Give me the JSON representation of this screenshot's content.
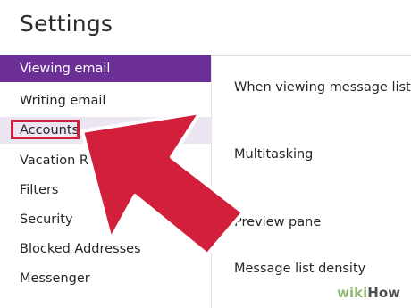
{
  "page": {
    "title": "Settings"
  },
  "sidebar": {
    "items": [
      {
        "label": "Viewing email",
        "state": "selected"
      },
      {
        "label": "Writing email",
        "state": "normal"
      },
      {
        "label": "Accounts",
        "state": "highlighted"
      },
      {
        "label": "Vacation Respo",
        "state": "normal"
      },
      {
        "label": "Filters",
        "state": "normal"
      },
      {
        "label": "Security",
        "state": "normal"
      },
      {
        "label": "Blocked Addresses",
        "state": "normal"
      },
      {
        "label": "Messenger",
        "state": "normal"
      }
    ]
  },
  "main": {
    "rows": [
      {
        "label": "When viewing message lists"
      },
      {
        "label": "Multitasking"
      },
      {
        "label": "Preview pane"
      },
      {
        "label": "Message list density"
      }
    ]
  },
  "watermark": {
    "part1": "wiki",
    "part2": "How"
  },
  "colors": {
    "selected_bg": "#6b2f95",
    "highlight_bg": "#ece6f3",
    "arrow_fill": "#d21f3c",
    "arrow_outline": "#ffffff",
    "watermark_green": "#93b874"
  },
  "icons": {
    "arrow": "red-pointer-arrow"
  }
}
